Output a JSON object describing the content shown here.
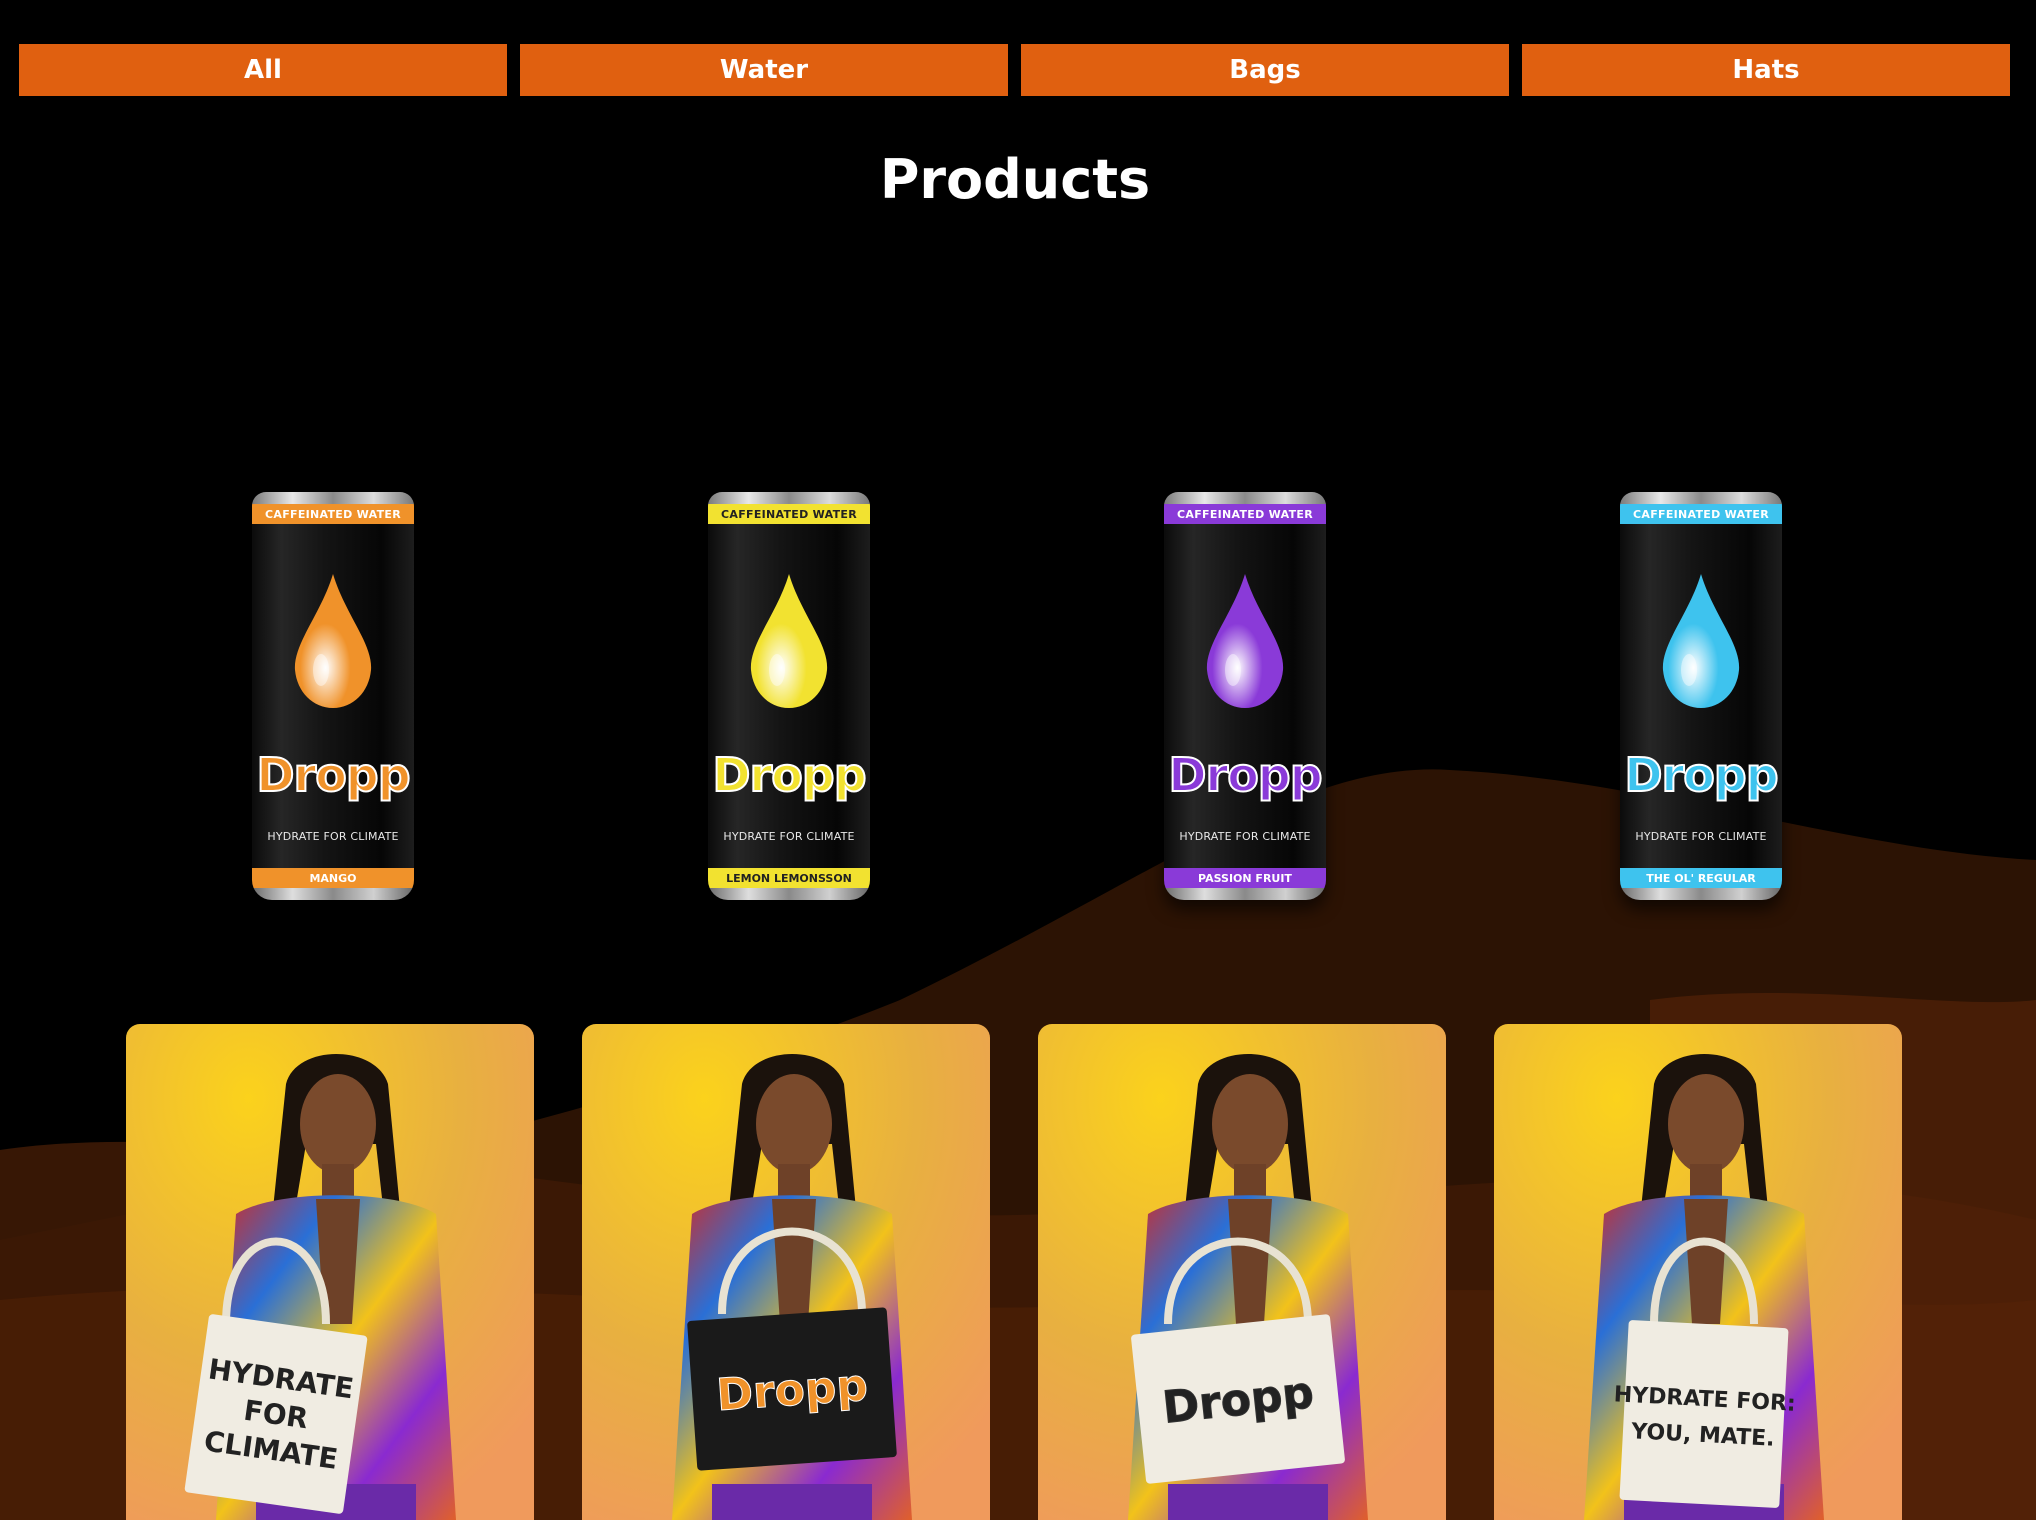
{
  "filters": [
    {
      "label": "All"
    },
    {
      "label": "Water"
    },
    {
      "label": "Bags"
    },
    {
      "label": "Hats"
    }
  ],
  "page_title": "Products",
  "colors": {
    "accent": "#e06010",
    "background": "#000000",
    "wave_dark": "#2c1304",
    "wave_mid": "#4a1f06"
  },
  "cans": [
    {
      "top_label": "CAFFEINATED WATER",
      "brand": "Dropp",
      "tagline": "HYDRATE FOR CLIMATE",
      "flavor": "MANGO",
      "color": "#f0922a"
    },
    {
      "top_label": "CAFFEINATED WATER",
      "brand": "Dropp",
      "tagline": "HYDRATE FOR CLIMATE",
      "flavor": "LEMON LEMONSSON",
      "color": "#f2e230"
    },
    {
      "top_label": "CAFFEINATED WATER",
      "brand": "Dropp",
      "tagline": "HYDRATE FOR CLIMATE",
      "flavor": "PASSION FRUIT",
      "color": "#8a3ad8"
    },
    {
      "top_label": "CAFFEINATED WATER",
      "brand": "Dropp",
      "tagline": "HYDRATE FOR CLIMATE",
      "flavor": "THE OL' REGULAR",
      "color": "#3ec3ee"
    }
  ],
  "bag_photos": [
    {
      "bag_text_lines": [
        "HYDRATE",
        "FOR",
        "CLIMATE"
      ]
    },
    {
      "bag_text_lines": [
        "Dropp"
      ]
    },
    {
      "bag_text_lines": [
        "Dropp"
      ]
    },
    {
      "bag_text_lines": [
        "HYDRATE FOR:",
        "YOU, MATE."
      ]
    }
  ]
}
